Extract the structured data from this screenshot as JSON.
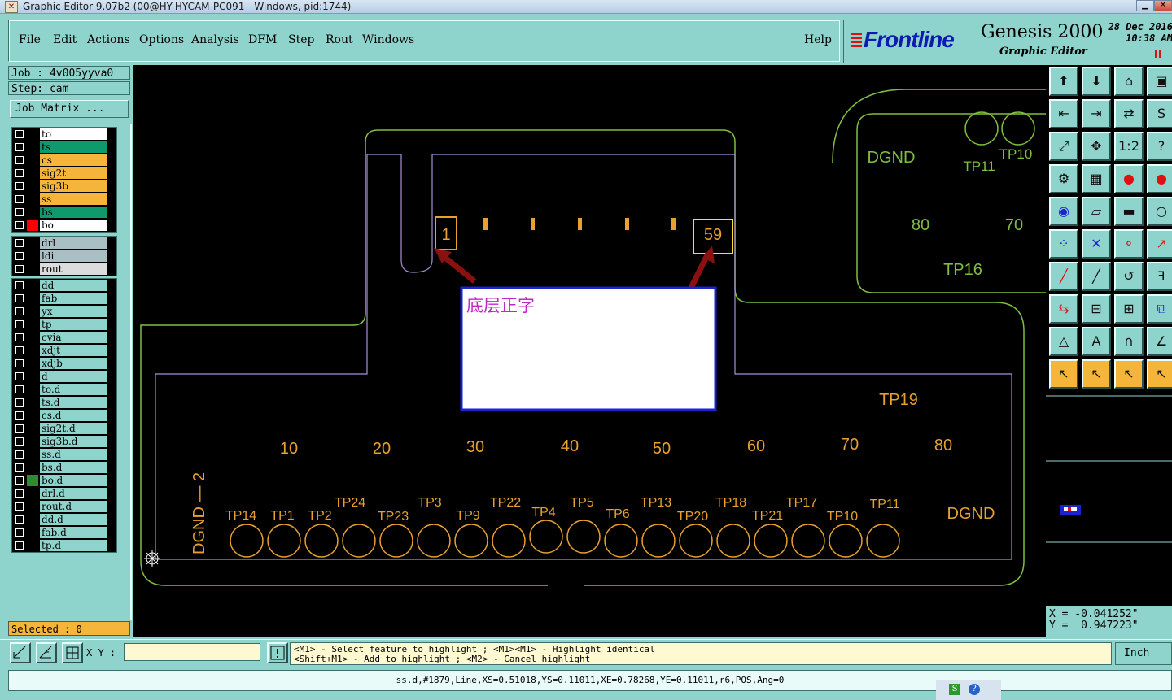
{
  "window": {
    "title": "Graphic Editor 9.07b2 (00@HY-HYCAM-PC091 - Windows, pid:1744)"
  },
  "menu": [
    "File",
    "Edit",
    "Actions",
    "Options",
    "Analysis",
    "DFM",
    "Step",
    "Rout",
    "Windows"
  ],
  "help_label": "Help",
  "brand": {
    "logo": "Frontline",
    "product": "Genesis 2000",
    "subtitle": "Graphic Editor",
    "date": "28 Dec 2016",
    "time": "10:38 AM"
  },
  "job": {
    "job_line": "Job : 4v005yyva0",
    "step_line": "Step: cam",
    "matrix_button": "Job Matrix ..."
  },
  "layers": {
    "group1": [
      {
        "name": "to",
        "bg": "#ffffff",
        "sq": "#000000"
      },
      {
        "name": "ts",
        "bg": "#0f9a6e",
        "sq": "#000000"
      },
      {
        "name": "cs",
        "bg": "#f5b53b",
        "sq": "#000000"
      },
      {
        "name": "sig2t",
        "bg": "#f5b53b",
        "sq": "#000000"
      },
      {
        "name": "sig3b",
        "bg": "#f5b53b",
        "sq": "#000000"
      },
      {
        "name": "ss",
        "bg": "#f5b53b",
        "sq": "#000000"
      },
      {
        "name": "bs",
        "bg": "#0f9a6e",
        "sq": "#000000"
      },
      {
        "name": "bo",
        "bg": "#ffffff",
        "sq": "#ff0000"
      }
    ],
    "group2": [
      {
        "name": "drl",
        "bg": "#a9bfc4",
        "sq": "#000000"
      },
      {
        "name": "ldi",
        "bg": "#a9bfc4",
        "sq": "#000000"
      },
      {
        "name": "rout",
        "bg": "#dcdcdc",
        "sq": "#000000"
      }
    ],
    "group3": [
      {
        "name": "dd",
        "bg": "#8fd4cc",
        "sq": "#000000"
      },
      {
        "name": "fab",
        "bg": "#8fd4cc",
        "sq": "#000000"
      },
      {
        "name": "yx",
        "bg": "#8fd4cc",
        "sq": "#000000"
      },
      {
        "name": "tp",
        "bg": "#8fd4cc",
        "sq": "#000000"
      },
      {
        "name": "cvia",
        "bg": "#8fd4cc",
        "sq": "#000000"
      },
      {
        "name": "xdjt",
        "bg": "#8fd4cc",
        "sq": "#000000"
      },
      {
        "name": "xdjb",
        "bg": "#8fd4cc",
        "sq": "#000000"
      },
      {
        "name": "d",
        "bg": "#8fd4cc",
        "sq": "#000000"
      },
      {
        "name": "to.d",
        "bg": "#8fd4cc",
        "sq": "#000000"
      },
      {
        "name": "ts.d",
        "bg": "#8fd4cc",
        "sq": "#000000"
      },
      {
        "name": "cs.d",
        "bg": "#8fd4cc",
        "sq": "#000000"
      },
      {
        "name": "sig2t.d",
        "bg": "#8fd4cc",
        "sq": "#000000"
      },
      {
        "name": "sig3b.d",
        "bg": "#8fd4cc",
        "sq": "#000000"
      },
      {
        "name": "ss.d",
        "bg": "#8fd4cc",
        "sq": "#000000"
      },
      {
        "name": "bs.d",
        "bg": "#8fd4cc",
        "sq": "#000000"
      },
      {
        "name": "bo.d",
        "bg": "#8fd4cc",
        "sq": "#2e8b2e"
      },
      {
        "name": "drl.d",
        "bg": "#8fd4cc",
        "sq": "#000000"
      },
      {
        "name": "rout.d",
        "bg": "#8fd4cc",
        "sq": "#000000"
      },
      {
        "name": "dd.d",
        "bg": "#8fd4cc",
        "sq": "#000000"
      },
      {
        "name": "fab.d",
        "bg": "#8fd4cc",
        "sq": "#000000"
      },
      {
        "name": "tp.d",
        "bg": "#8fd4cc",
        "sq": "#000000"
      }
    ]
  },
  "selected_label": "Selected : 0",
  "canvas": {
    "pin_first": "1",
    "pin_last": "59",
    "annotation": "底层正字",
    "scale_numbers": [
      "10",
      "20",
      "30",
      "40",
      "50",
      "60",
      "70",
      "80"
    ],
    "upper_right_numbers": [
      "80",
      "70"
    ],
    "dgnd": "DGND",
    "tp_top": "TP10",
    "tp_mid": "TP11",
    "tp16": "TP16",
    "tp19": "TP19",
    "connector_label": "DGND — 2",
    "tp_row_upper": [
      "TP24",
      "TP3",
      "TP22",
      "TP4",
      "TP5",
      "TP13",
      "TP18",
      "TP17",
      "TP11"
    ],
    "tp_row_lower": [
      "TP14",
      "TP1",
      "TP2",
      "TP23",
      "TP9",
      "TP6",
      "TP20",
      "TP21",
      "TP10"
    ]
  },
  "coords": {
    "x": "X = -0.041252\"",
    "y": "Y =  0.947223\""
  },
  "bottom": {
    "xy_label": "X Y :",
    "xy_value": "",
    "hint1": "<M1> - Select feature to highlight ; <M1><M1> - Highlight identical",
    "hint2": "<Shift+M1> - Add to highlight ; <M2> - Cancel highlight",
    "units": "Inch"
  },
  "status": "ss.d,#1879,Line,XS=0.51018,YS=0.11011,XE=0.78268,YE=0.11011,r6,POS,Ang=0",
  "colors": {
    "panel": "#8fd4cc",
    "orange": "#f5b53b",
    "outline_green": "#7fbf3f",
    "text_orange": "#e8a030"
  }
}
